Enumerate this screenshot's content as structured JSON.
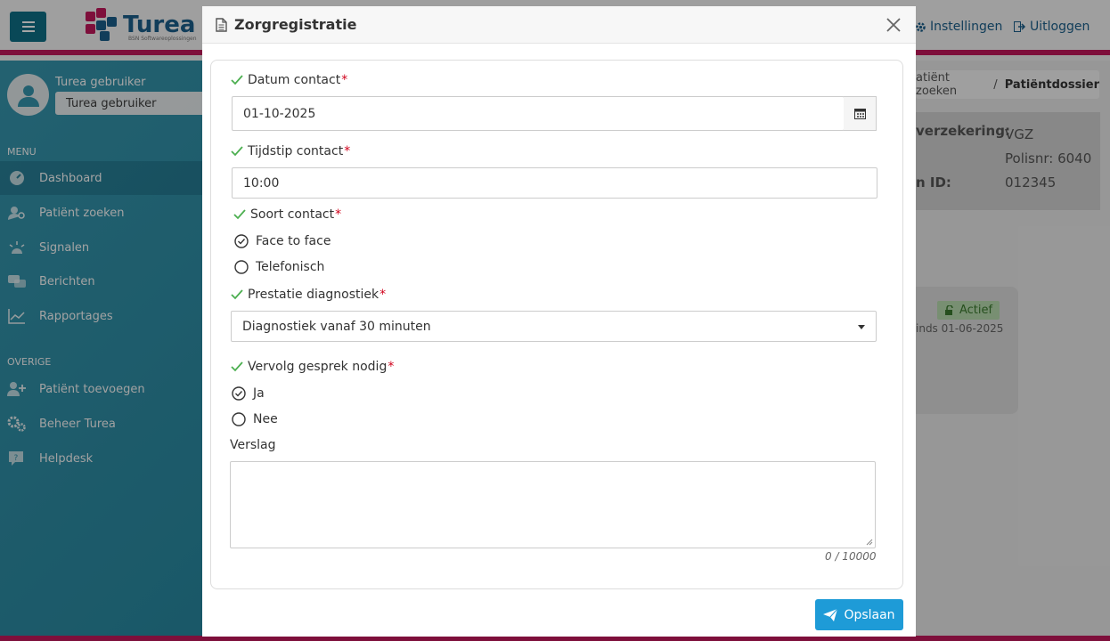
{
  "app": {
    "logo_text": "Turea",
    "logo_subtext": "BSN Softwareoplossingen",
    "nav_links": {
      "settings": "Instellingen",
      "logout": "Uitloggen"
    },
    "user": {
      "name": "Turea gebruiker",
      "select_value": "Turea gebruiker"
    },
    "menu_label": "MENU",
    "menu_items": [
      {
        "label": "Dashboard"
      },
      {
        "label": "Patiënt zoeken"
      },
      {
        "label": "Signalen"
      },
      {
        "label": "Berichten"
      },
      {
        "label": "Rapportages"
      }
    ],
    "other_label": "OVERIGE",
    "other_items": [
      {
        "label": "Patiënt toevoegen"
      },
      {
        "label": "Beheer Turea"
      },
      {
        "label": "Helpdesk"
      }
    ],
    "breadcrumb": {
      "item1": "atiënt zoeken",
      "separator": "/",
      "current": "Patiëntdossier"
    },
    "info": {
      "insurer_label": "verzekering:",
      "insurer_value": "VGZ",
      "policy": "Polisnr: 6040",
      "id_label": "n ID:",
      "id_value": "012345"
    },
    "status_badge": "Actief",
    "status_since": "inds 01-06-2025"
  },
  "modal": {
    "title": "Zorgregistratie",
    "fields": {
      "date": {
        "label": "Datum contact",
        "value": "01-10-2025"
      },
      "time": {
        "label": "Tijdstip contact",
        "value": "10:00"
      },
      "contact_type": {
        "label": "Soort contact",
        "options": [
          "Face to face",
          "Telefonisch"
        ],
        "selected": "Face to face"
      },
      "diagnostic": {
        "label": "Prestatie diagnostiek",
        "value": "Diagnostiek vanaf 30 minuten"
      },
      "followup": {
        "label": "Vervolg gesprek nodig",
        "options": [
          "Ja",
          "Nee"
        ],
        "selected": "Ja"
      },
      "report": {
        "label": "Verslag",
        "value": "",
        "counter": "0 / 10000"
      }
    },
    "required_marker": "*",
    "save_label": "Opslaan"
  },
  "colors": {
    "accent": "#1e9bd7",
    "brand": "#c2185b",
    "sidebar": "#2a8fa8",
    "valid_check": "#4caf50",
    "required": "#d0021b"
  }
}
